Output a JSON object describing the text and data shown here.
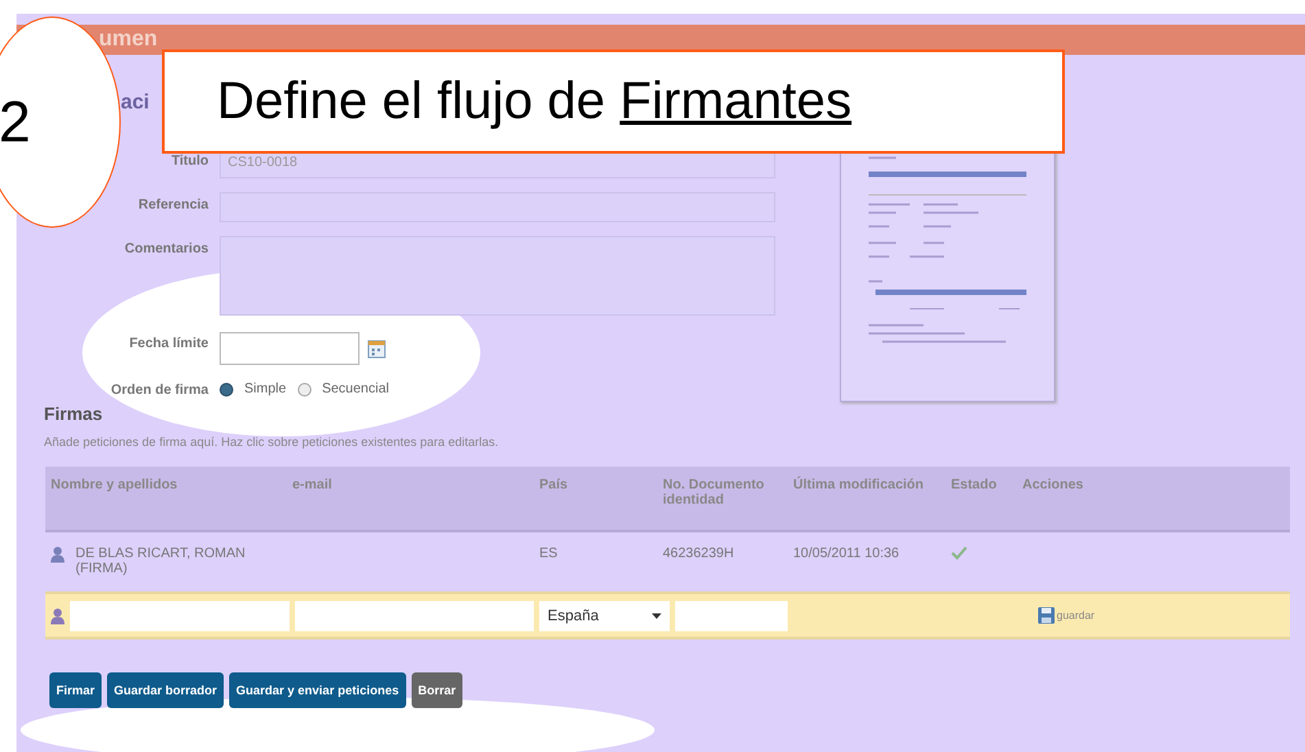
{
  "annotation": {
    "step": "2",
    "callout": {
      "text": "Define el flujo de ",
      "emphasis": "Firmantes"
    }
  },
  "header": {
    "title_fragment": "umen"
  },
  "section": {
    "title_fragment": "aci"
  },
  "form": {
    "fields": [
      {
        "label": "Titulo",
        "value": "CS10-0018",
        "kind": "text"
      },
      {
        "label": "Referencia",
        "kind": "text"
      },
      {
        "label": "Comentarios",
        "kind": "textarea"
      },
      {
        "label": "Fecha límite",
        "kind": "date"
      }
    ],
    "order": {
      "label": "Orden de firma",
      "options": [
        {
          "label": "Simple",
          "selected": true
        },
        {
          "label": "Secuencial",
          "selected": false
        }
      ]
    }
  },
  "signatures": {
    "title": "Firmas",
    "hint": "Añade peticiones de firma aquí. Haz clic sobre peticiones existentes para editarlas.",
    "columns": [
      "Nombre y apellidos",
      "e-mail",
      "País",
      "No. Documento identidad",
      "Última modificación",
      "Estado",
      "Acciones"
    ],
    "rows": [
      {
        "name": "DE BLAS RICART, ROMAN (FIRMA)",
        "country": "ES",
        "document": "46236239H",
        "modified": "10/05/2011 10:36",
        "signed": true
      }
    ],
    "new_row": {
      "country": "España",
      "action": "guardar"
    }
  },
  "buttons": [
    {
      "label": "Firmar",
      "kind": "primary"
    },
    {
      "label": "Guardar borrador",
      "kind": "primary"
    },
    {
      "label": "Guardar y enviar peticiones",
      "kind": "primary"
    },
    {
      "label": "Borrar",
      "kind": "secondary"
    }
  ]
}
